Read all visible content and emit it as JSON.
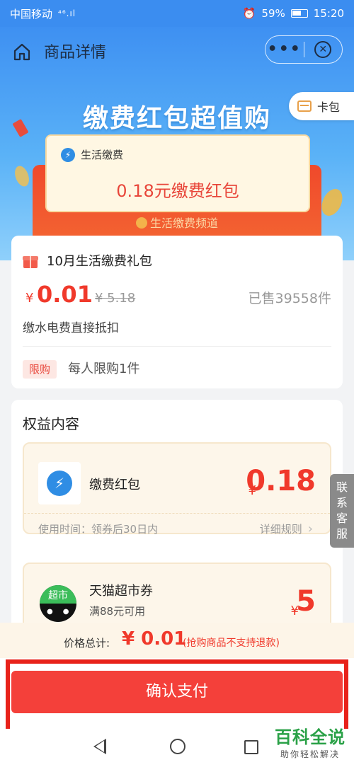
{
  "status_bar": {
    "carrier": "中国移动",
    "signal": "⁴⁶.ıl",
    "battery_percent": "59%",
    "time": "15:20"
  },
  "nav": {
    "title": "商品详情",
    "more": "•••",
    "card_pkg": "卡包"
  },
  "hero": {
    "title": "缴费红包超值购",
    "voucher_tag": "生活缴费",
    "voucher_amount": "0.18元缴费红包",
    "channel": "生活缴费频道"
  },
  "product": {
    "title": "10月生活缴费礼包",
    "currency": "¥",
    "price": "0.01",
    "original_price": "¥ 5.18",
    "sold": "已售39558件",
    "description": "缴水电费直接抵扣",
    "limit_badge": "限购",
    "limit_text": "每人限购1件"
  },
  "benefits": {
    "title": "权益内容",
    "items": [
      {
        "name": "缴费红包",
        "currency": "¥",
        "value": "0.18",
        "usage": "使用时间：领券后30日内",
        "rule": "详细规则"
      },
      {
        "name": "天猫超市券",
        "icon_text": "超市",
        "subtitle": "满88元可用",
        "currency": "¥",
        "value": "5"
      }
    ]
  },
  "side_service": [
    "联",
    "系",
    "客",
    "服"
  ],
  "total": {
    "label": "价格总计:",
    "value": "¥ 0.01",
    "note": "(抢购商品不支持退款)"
  },
  "pay_button": "确认支付",
  "watermark": {
    "line1": "百科全说",
    "line2": "助你轻松解决"
  },
  "colors": {
    "accent_red": "#f0392b",
    "hero_blue": "#3e90f2",
    "highlight_frame": "#e8221a"
  }
}
